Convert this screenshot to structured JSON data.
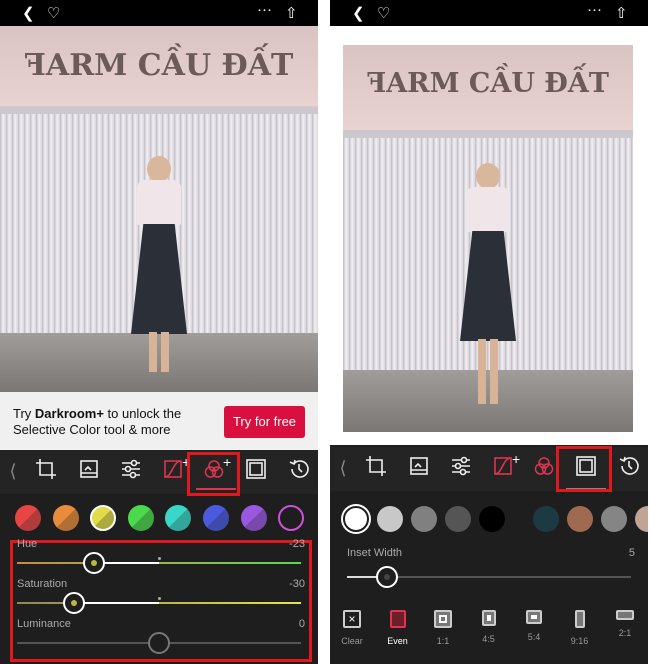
{
  "left_screen": {
    "topbar": {
      "back_icon": "chevron-left-icon",
      "favorite_icon": "heart-icon",
      "more_icon": "ellipsis-icon",
      "share_icon": "share-icon"
    },
    "photo": {
      "sign_text": "ꟻARM CẦU ĐẤT"
    },
    "banner": {
      "text_prefix": "Try ",
      "text_bold": "Darkroom+",
      "text_suffix": " to unlock the",
      "text_line2": "Selective Color tool & more",
      "button": "Try for free"
    },
    "toolbar": {
      "active": "selective-color",
      "items": [
        "back",
        "crop",
        "filters",
        "adjust",
        "curves",
        "selective-color",
        "frame",
        "history"
      ],
      "plus": "+"
    },
    "swatches": [
      "#e84545",
      "#e98b3c",
      "#e3dc4a",
      "#4bd94e",
      "#3ad7c8",
      "#4a5be0",
      "#9a58e0",
      "#d04fd8"
    ],
    "selected_swatch": 2,
    "sliders": [
      {
        "label": "Hue",
        "value": "-23",
        "level": -23
      },
      {
        "label": "Saturation",
        "value": "-30",
        "level": -30
      },
      {
        "label": "Luminance",
        "value": "0",
        "level": 0
      }
    ],
    "accent_color": "#e0191f"
  },
  "right_screen": {
    "topbar": {
      "back_icon": "chevron-left-icon",
      "favorite_icon": "heart-icon",
      "more_icon": "ellipsis-icon",
      "share_icon": "share-icon"
    },
    "photo": {
      "sign_text": "ꟻARM CẦU ĐẤT"
    },
    "toolbar": {
      "active": "frame",
      "items": [
        "back",
        "crop",
        "filters",
        "adjust",
        "curves",
        "selective-color",
        "frame",
        "history"
      ],
      "plus": "+"
    },
    "swatches": [
      "#ffffff",
      "#c8c8c8",
      "#808080",
      "#555555",
      "#000000",
      "#1c3a44",
      "#a06a52",
      "#858585",
      "#c2a497"
    ],
    "inset_width": {
      "label": "Inset Width",
      "value": "5",
      "level": 5
    },
    "frame_options": [
      "Clear",
      "Even",
      "1:1",
      "4:5",
      "5:4",
      "9:16",
      "2:1"
    ],
    "selected_frame": "Even"
  }
}
